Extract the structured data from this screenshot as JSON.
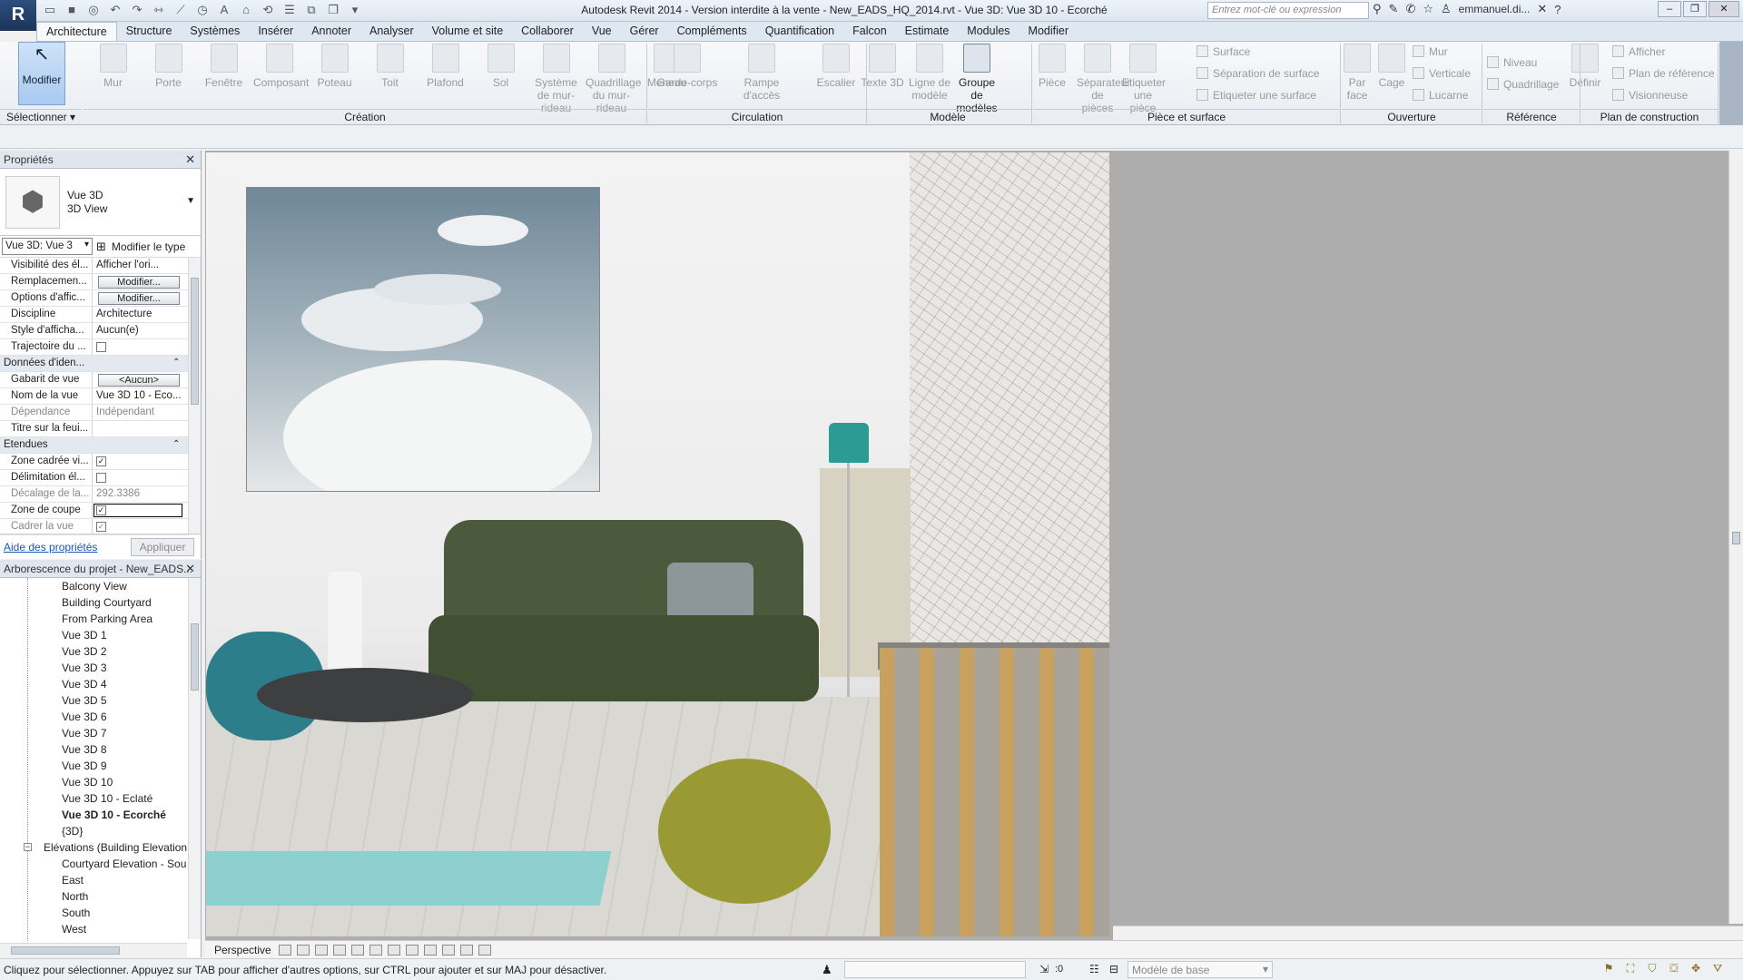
{
  "titlebar": {
    "window_title": "Autodesk Revit 2014 - Version interdite à la vente -    New_EADS_HQ_2014.rvt - Vue 3D: Vue 3D 10 - Ecorché",
    "search_placeholder": "Entrez mot-clé ou expression",
    "user": "emmanuel.di...",
    "help": "?",
    "app_icon": "R"
  },
  "ribbon_tabs": [
    "Architecture",
    "Structure",
    "Systèmes",
    "Insérer",
    "Annoter",
    "Analyser",
    "Volume et site",
    "Collaborer",
    "Vue",
    "Gérer",
    "Compléments",
    "Quantification",
    "Falcon",
    "Estimate",
    "Modules",
    "Modifier"
  ],
  "ribbon": {
    "modify": "Modifier",
    "select": "Sélectionner",
    "creation": [
      "Mur",
      "Porte",
      "Fenêtre",
      "Composant",
      "Poteau",
      "Toit",
      "Plafond",
      "Sol",
      "Système de mur-rideau",
      "Quadrillage du mur-rideau",
      "Meneau"
    ],
    "circulation": [
      "Garde-corps",
      "Rampe d'accès",
      "Escalier"
    ],
    "modele": [
      "Texte 3D",
      "Ligne de modèle",
      "Groupe de modèles"
    ],
    "piece": [
      "Pièce",
      "Séparateur de pièces",
      "Etiqueter une pièce"
    ],
    "piece_small": [
      "Surface",
      "Séparation  de surface",
      "Etiqueter  une surface"
    ],
    "ouverture": [
      "Par face",
      "Cage"
    ],
    "ouverture_small": [
      "Mur",
      "Verticale",
      "Lucarne"
    ],
    "reference": [
      "Niveau",
      "Quadrillage"
    ],
    "plan": [
      "Définir"
    ],
    "plan_small": [
      "Afficher",
      "Plan de référence",
      "Visionneuse"
    ],
    "panels": [
      "Création",
      "Circulation",
      "Modèle",
      "Pièce et surface",
      "Ouverture",
      "Référence",
      "Plan de construction"
    ]
  },
  "properties": {
    "header": "Propriétés",
    "type_line1": "Vue 3D",
    "type_line2": "3D View",
    "instance_selector": "Vue 3D: Vue 3",
    "edit_type": "Modifier le type",
    "rows": [
      {
        "k": "Visibilité des él...",
        "v": "Afficher l'ori..."
      },
      {
        "k": "Remplacemen...",
        "btn": "Modifier..."
      },
      {
        "k": "Options d'affic...",
        "btn": "Modifier..."
      },
      {
        "k": "Discipline",
        "v": "Architecture"
      },
      {
        "k": "Style d'afficha...",
        "v": "Aucun(e)"
      },
      {
        "k": "Trajectoire du ...",
        "chk": ""
      }
    ],
    "group_identity": "Données d'iden...",
    "identity_rows": [
      {
        "k": "Gabarit de vue",
        "btn": "<Aucun>"
      },
      {
        "k": "Nom de la vue",
        "v": "Vue 3D 10 - Eco..."
      },
      {
        "k": "Dépendance",
        "v": "Indépendant"
      },
      {
        "k": "Titre sur la feui...",
        "v": ""
      }
    ],
    "group_extents": "Etendues",
    "extent_rows": [
      {
        "k": "Zone cadrée vi...",
        "chk": "✓"
      },
      {
        "k": "Délimitation él...",
        "chk": ""
      },
      {
        "k": "Décalage de la...",
        "v": "292.3386"
      },
      {
        "k": "Zone de coupe",
        "chk": "✓"
      },
      {
        "k": "Cadrer la vue",
        "chk": "✓"
      }
    ],
    "help_link": "Aide des propriétés",
    "apply": "Appliquer"
  },
  "browser": {
    "header": "Arborescence du projet - New_EADS...",
    "views": [
      "Balcony View",
      "Building Courtyard",
      "From Parking Area",
      "Vue 3D 1",
      "Vue 3D 2",
      "Vue 3D 3",
      "Vue 3D 4",
      "Vue 3D 5",
      "Vue 3D 6",
      "Vue 3D 7",
      "Vue 3D 8",
      "Vue 3D 9",
      "Vue 3D 10",
      "Vue 3D 10 - Eclaté",
      "Vue 3D 10 - Ecorché",
      "{3D}"
    ],
    "active_view": "Vue 3D 10 - Ecorché",
    "elevations_group": "Elévations (Building Elevation",
    "elevations": [
      "Courtyard Elevation - Sou",
      "East",
      "North",
      "South",
      "West"
    ]
  },
  "view_bar": {
    "mode": "Perspective"
  },
  "status_bar": {
    "message": "Cliquez pour sélectionner. Appuyez sur TAB pour afficher d'autres options, sur CTRL pour ajouter et sur MAJ pour désactiver.",
    "zero": ":0",
    "model": "Modèle de base"
  }
}
